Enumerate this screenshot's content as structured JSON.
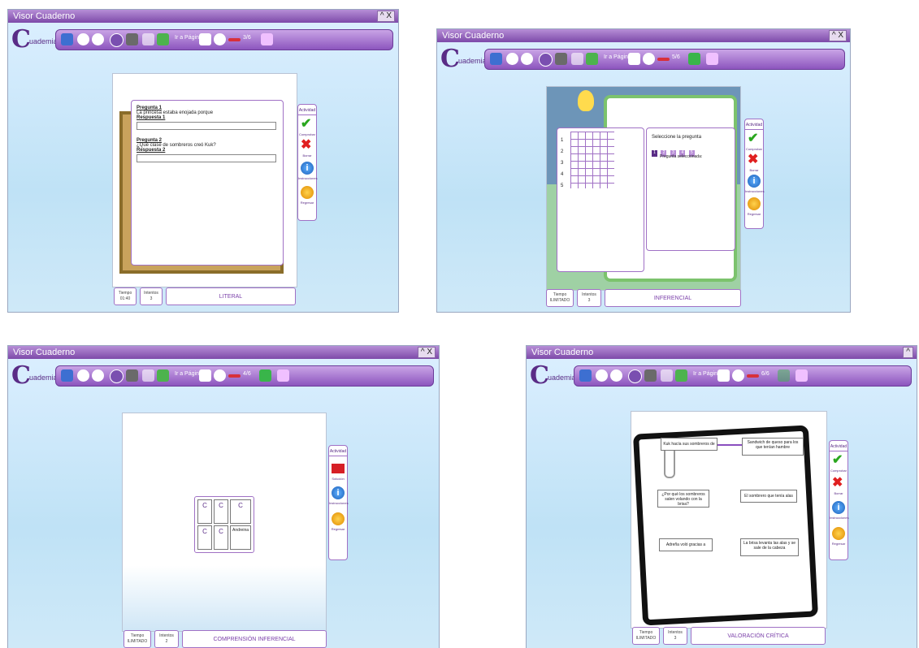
{
  "app_title": "Visor Cuaderno",
  "logo_text": "uademia",
  "window_controls": "^ X",
  "toolbar": {
    "goto_label": "Ir a Página"
  },
  "panel": {
    "header": "Actividad",
    "labels": {
      "comprobar": "Comprobar",
      "borrar": "Borrar",
      "instrucciones": "Instrucciones",
      "regresar": "Regresar",
      "solucion": "Solución"
    }
  },
  "screens": [
    {
      "page_indicator": "3/6",
      "q1_title": "Pregunta 1",
      "q1_text": "La princesa estaba enojada porque",
      "a1_title": "Respuesta 1",
      "q2_title": "Pregunta 2",
      "q2_text": "¿Qué clase de sombreros creó Kuk?",
      "a2_title": "Respuesta 2",
      "footer_time_label": "Tiempo",
      "footer_time_value": "01:40",
      "footer_tries_label": "Intentos",
      "footer_tries_value": "3",
      "footer_title": "LITERAL"
    },
    {
      "page_indicator": "5/6",
      "grid_numbers": [
        "1",
        "2",
        "3",
        "4",
        "5"
      ],
      "select_label": "Seleccione la pregunta",
      "select_options": [
        "1",
        "2",
        "3",
        "4",
        "5"
      ],
      "selected_text": "Pregunta seleccionada:",
      "footer_time_label": "Tiempo",
      "footer_time_value": "ILIMITADO",
      "footer_tries_label": "Intentos",
      "footer_tries_value": "3",
      "footer_title": "INFERENCIAL"
    },
    {
      "page_indicator": "4/6",
      "memory_label": "Andreina",
      "footer_time_label": "Tiempo",
      "footer_time_value": "ILIMITADO",
      "footer_tries_label": "Intentos",
      "footer_tries_value": "2",
      "footer_title": "COMPRENSIÓN INFERENCIAL"
    },
    {
      "page_indicator": "6/6",
      "cards_left": [
        "Kuk hacía sus sombreros de",
        "¿Por qué los sombreros salen volando con la brisa?",
        "Adreña voló gracias a"
      ],
      "cards_right": [
        "Sandwich de queso para los que tenían hambre",
        "El sombrero que tenía alas",
        "La brisa levanta las alas y se sale de la cabeza"
      ],
      "footer_time_label": "Tiempo",
      "footer_time_value": "ILIMITADO",
      "footer_tries_label": "Intentos",
      "footer_tries_value": "3",
      "footer_title": "VALORACIÓN CRÍTICA"
    }
  ]
}
